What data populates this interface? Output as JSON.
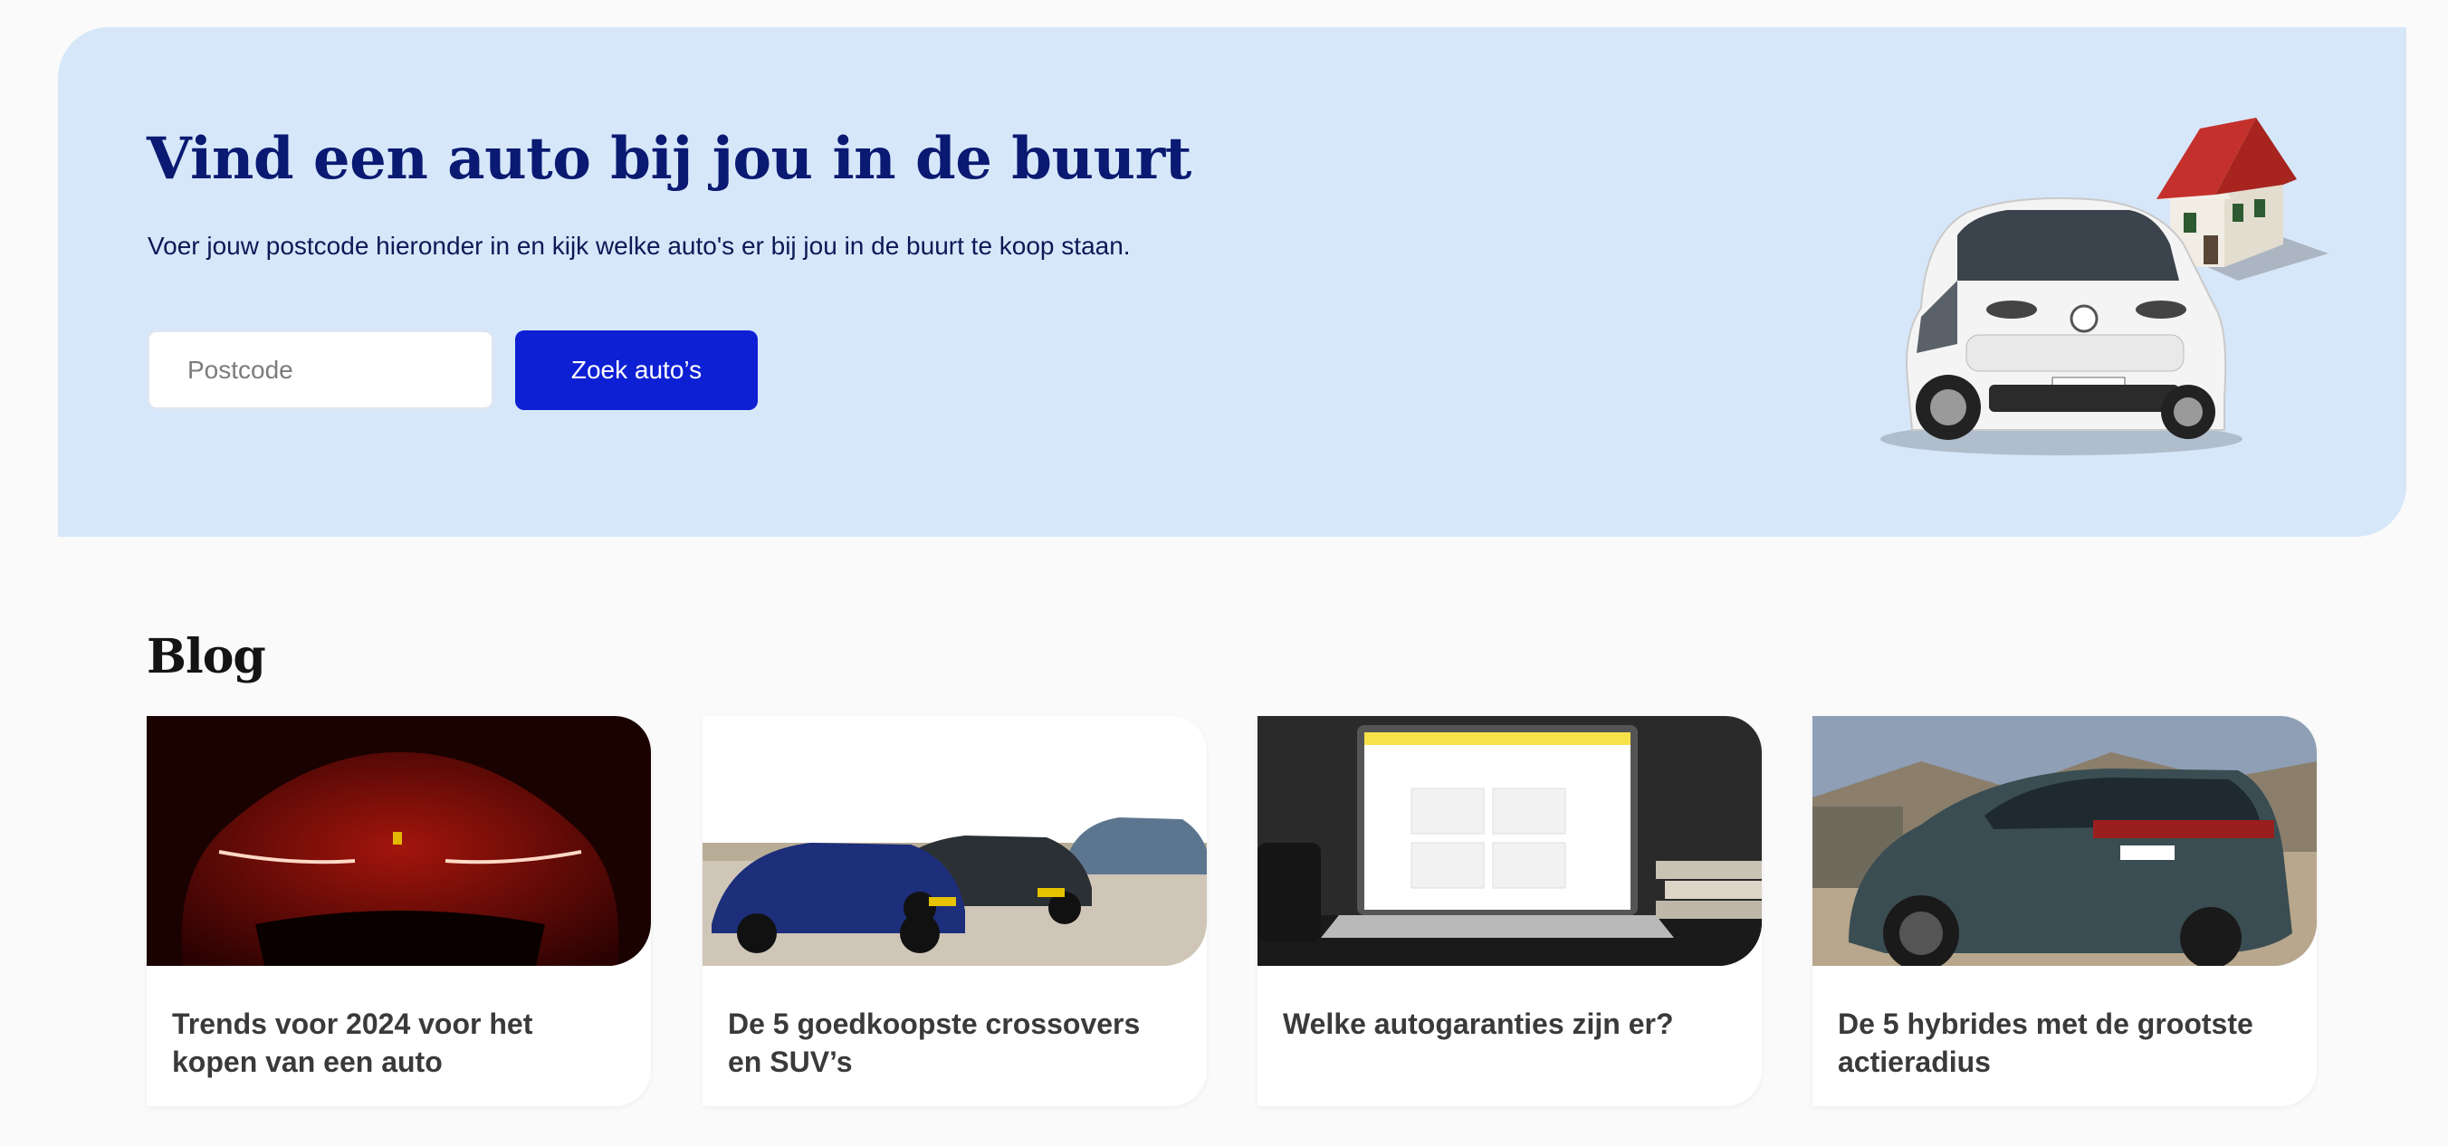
{
  "hero": {
    "title": "Vind een auto bij jou in de buurt",
    "subtitle": "Voer jouw postcode hieronder in en kijk welke auto's er bij jou in de buurt te koop staan.",
    "postcode_placeholder": "Postcode",
    "postcode_value": "",
    "search_label": "Zoek auto’s",
    "image_alt": "car-and-house-illustration"
  },
  "blog": {
    "title": "Blog",
    "cards": [
      {
        "title": "Trends voor 2024 voor het kopen van een auto",
        "image": "red-sports-car-image"
      },
      {
        "title": "De 5 goedkoopste crossovers en SUV’s",
        "image": "suv-lineup-image"
      },
      {
        "title": "Welke autogaranties zijn er?",
        "image": "laptop-image"
      },
      {
        "title": "De 5 hybrides met de grootste actieradius",
        "image": "hybrid-suv-image"
      }
    ]
  },
  "colors": {
    "hero_bg": "#d7e7fa",
    "brand_navy": "#0a1a72",
    "button_blue": "#0e20d4",
    "page_bg": "#fafafa"
  }
}
